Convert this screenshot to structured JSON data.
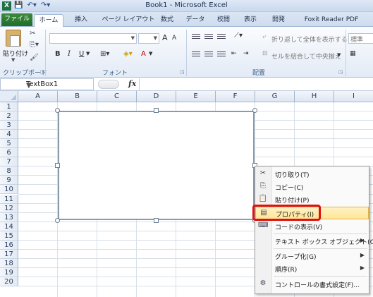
{
  "window": {
    "title": "Book1 - Microsoft Excel",
    "app_icon": "X"
  },
  "quick_access": [
    "save-icon",
    "undo-icon",
    "redo-icon"
  ],
  "tabs": [
    {
      "label": "ファイル"
    },
    {
      "label": "ホーム"
    },
    {
      "label": "挿入"
    },
    {
      "label": "ページ レイアウト"
    },
    {
      "label": "数式"
    },
    {
      "label": "データ"
    },
    {
      "label": "校閲"
    },
    {
      "label": "表示"
    },
    {
      "label": "開発"
    },
    {
      "label": "Foxit Reader PDF"
    }
  ],
  "ribbon": {
    "clipboard": {
      "paste_label": "貼り付け",
      "group_label": "クリップボード"
    },
    "font": {
      "group_label": "フォント",
      "bold": "B",
      "italic": "I",
      "underline": "U",
      "grow": "A",
      "shrink": "A",
      "font_color": "A"
    },
    "alignment": {
      "group_label": "配置",
      "wrap_text": "折り返して全体を表示する",
      "merge_center": "セルを結合して中央揃え"
    },
    "number": {
      "format": "標準"
    }
  },
  "formula_bar": {
    "name_box": "TextBox1",
    "fx": "fx",
    "value": ""
  },
  "columns": [
    "A",
    "B",
    "C",
    "D",
    "E",
    "F",
    "G",
    "H",
    "I"
  ],
  "rows": [
    "1",
    "2",
    "3",
    "4",
    "5",
    "6",
    "7",
    "8",
    "9",
    "10",
    "11",
    "12",
    "13",
    "14",
    "15",
    "16",
    "17",
    "18",
    "19",
    "20"
  ],
  "context_menu": {
    "items": [
      {
        "label": "切り取り(T)",
        "icon": "scissors-icon"
      },
      {
        "label": "コピー(C)",
        "icon": "copy-icon"
      },
      {
        "label": "貼り付け(P)",
        "icon": "paste-icon"
      },
      {
        "label": "プロパティ(I)",
        "icon": "properties-icon",
        "highlighted": true
      },
      {
        "label": "コードの表示(V)",
        "icon": "view-code-icon"
      },
      {
        "label": "テキスト ボックス オブジェクト(O)",
        "submenu": true
      },
      {
        "label": "グループ化(G)",
        "submenu": true
      },
      {
        "label": "順序(R)",
        "submenu": true
      },
      {
        "label": "コントロールの書式設定(F)...",
        "icon": "format-control-icon"
      }
    ]
  },
  "colors": {
    "file_tab": "#1f6e2b",
    "highlight_border": "#e01010",
    "menu_highlight": "#ffe596"
  }
}
